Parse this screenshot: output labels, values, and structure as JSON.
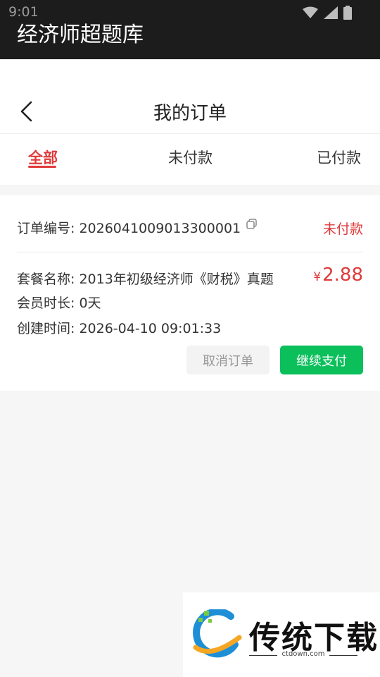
{
  "status_bar": {
    "time": "9:01",
    "app_title": "经济师超题库"
  },
  "header": {
    "title": "我的订单"
  },
  "tabs": [
    {
      "label": "全部",
      "active": true
    },
    {
      "label": "未付款",
      "active": false
    },
    {
      "label": "已付款",
      "active": false
    }
  ],
  "order": {
    "id_label": "订单编号: 2026041009013300001",
    "status": "未付款",
    "package": "套餐名称: 2013年初级经济师《财税》真题",
    "duration": "会员时长: 0天",
    "created": "创建时间: 2026-04-10 09:01:33",
    "price_symbol": "¥",
    "price": "2.88",
    "cancel_label": "取消订单",
    "pay_label": "继续支付"
  },
  "watermark": {
    "brand": "传统下载",
    "domain": "ctdown.com"
  },
  "colors": {
    "accent_red": "#e03a3a",
    "pay_green": "#0bbf5b",
    "status_bar": "#1c1c1c"
  }
}
